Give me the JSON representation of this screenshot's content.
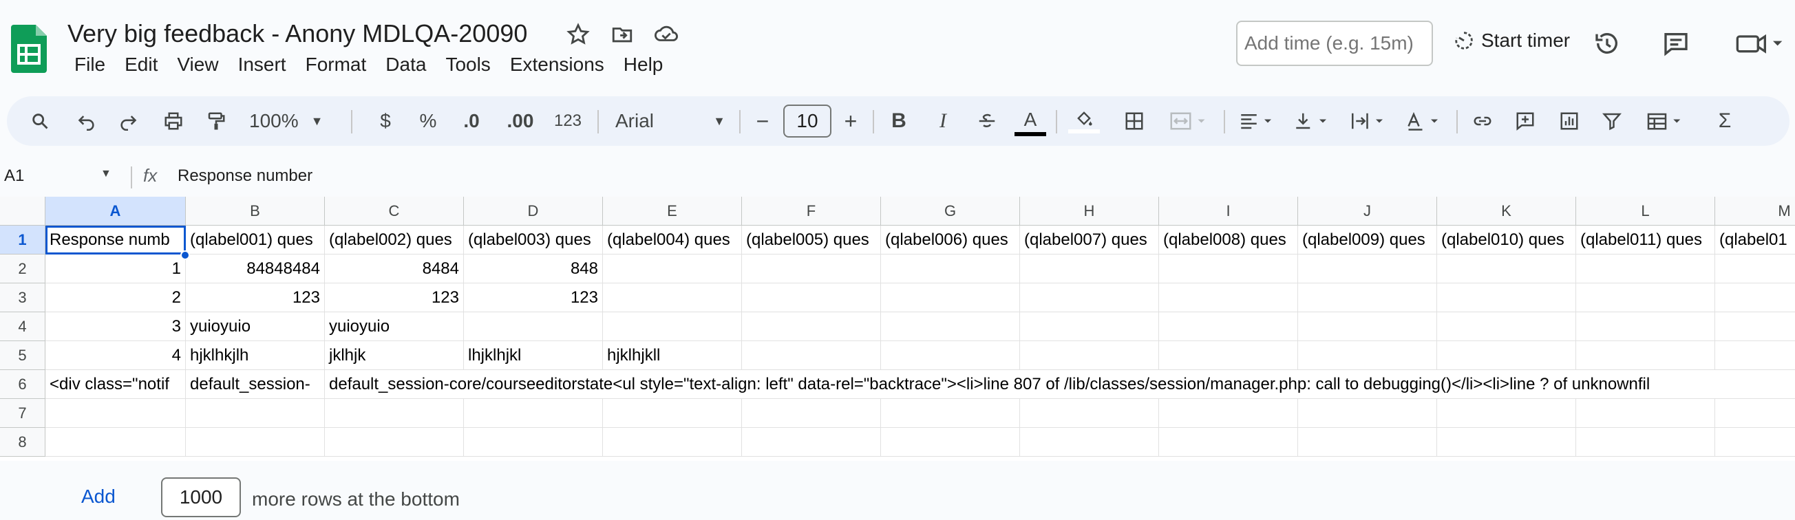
{
  "doc": {
    "title": "Very big feedback - Anony MDLQA-20090"
  },
  "menu": [
    "File",
    "Edit",
    "View",
    "Insert",
    "Format",
    "Data",
    "Tools",
    "Extensions",
    "Help"
  ],
  "header": {
    "time_placeholder": "Add time (e.g. 15m)",
    "start_timer": "Start timer"
  },
  "toolbar": {
    "zoom": "100%",
    "currency": "$",
    "percent": "%",
    "decrease_decimal": ".0",
    "increase_decimal": ".00",
    "number_format": "123",
    "font": "Arial",
    "font_size": "10",
    "minus": "−",
    "plus": "+",
    "bold": "B",
    "italic": "I",
    "text_color": "A",
    "sum": "Σ"
  },
  "formula_bar": {
    "cell_ref": "A1",
    "fx": "fx",
    "content": "Response number"
  },
  "columns": [
    "A",
    "B",
    "C",
    "D",
    "E",
    "F",
    "G",
    "H",
    "I",
    "J",
    "K",
    "L",
    "M"
  ],
  "rows": [
    "1",
    "2",
    "3",
    "4",
    "5",
    "6",
    "7",
    "8"
  ],
  "cells": {
    "r1": [
      "Response numb",
      "(qlabel001) ques",
      "(qlabel002) ques",
      "(qlabel003) ques",
      "(qlabel004) ques",
      "(qlabel005) ques",
      "(qlabel006) ques",
      "(qlabel007) ques",
      "(qlabel008) ques",
      "(qlabel009) ques",
      "(qlabel010) ques",
      "(qlabel011) ques",
      "(qlabel01"
    ],
    "r2": [
      "1",
      "84848484",
      "8484",
      "848"
    ],
    "r3": [
      "2",
      "123",
      "123",
      "123"
    ],
    "r4": [
      "3",
      "yuioyuio",
      "",
      "yuioyuio"
    ],
    "r5": [
      "4",
      "hjklhkjlh",
      "jklhjk",
      "lhjklhjkl",
      "hjklhjkll"
    ],
    "r6": [
      "<div class=\"notif",
      "default_session-",
      "default_session-core/courseeditorstate<ul style=\"text-align: left\" data-rel=\"backtrace\"><li>line 807 of /lib/classes/session/manager.php: call to debugging()</li><li>line ? of unknownfil"
    ]
  },
  "bottom": {
    "add_label": "Add",
    "rows_value": "1000",
    "more_text": "more rows at the bottom"
  },
  "colors": {
    "accent": "#0b57d0",
    "selection_header": "#d3e3fd",
    "logo_green": "#0f9d58"
  }
}
